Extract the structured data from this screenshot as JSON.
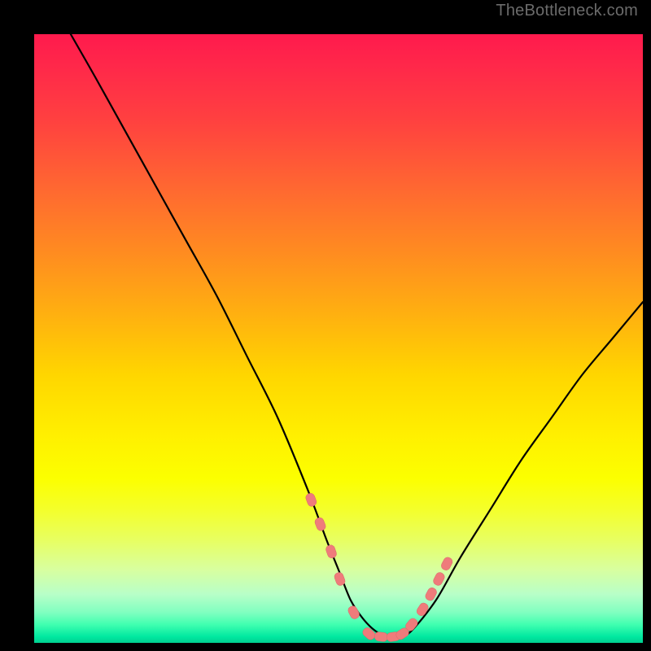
{
  "attribution": "TheBottleneck.com",
  "colors": {
    "marker_fill": "#ef7b7b",
    "marker_stroke": "#d86a6a",
    "curve_stroke": "#000000",
    "gradient_top": "#ff1a4d",
    "gradient_bottom": "#00d090",
    "background": "#000000"
  },
  "chart_data": {
    "type": "line",
    "title": "",
    "xlabel": "",
    "ylabel": "",
    "xlim": [
      0,
      100
    ],
    "ylim": [
      0,
      100
    ],
    "grid": false,
    "legend": false,
    "series": [
      {
        "name": "bottleneck-curve",
        "x": [
          6,
          10,
          15,
          20,
          25,
          30,
          35,
          40,
          45,
          48,
          50,
          52,
          54,
          56,
          58,
          60,
          62,
          66,
          70,
          75,
          80,
          85,
          90,
          95,
          100
        ],
        "y": [
          100,
          93,
          84,
          75,
          66,
          57,
          47,
          37,
          25,
          17,
          12,
          7,
          4,
          2,
          1,
          1,
          2,
          7,
          14,
          22,
          30,
          37,
          44,
          50,
          56
        ]
      }
    ],
    "markers": {
      "name": "highlighted-points",
      "x": [
        45.5,
        47.0,
        48.8,
        50.2,
        52.5,
        55.0,
        57.0,
        59.0,
        60.5,
        62.0,
        63.8,
        65.2,
        66.5,
        67.8
      ],
      "y": [
        23.5,
        19.5,
        15.0,
        10.5,
        5.0,
        1.5,
        1.0,
        1.0,
        1.5,
        3.0,
        5.5,
        8.0,
        10.5,
        13.0
      ]
    }
  }
}
